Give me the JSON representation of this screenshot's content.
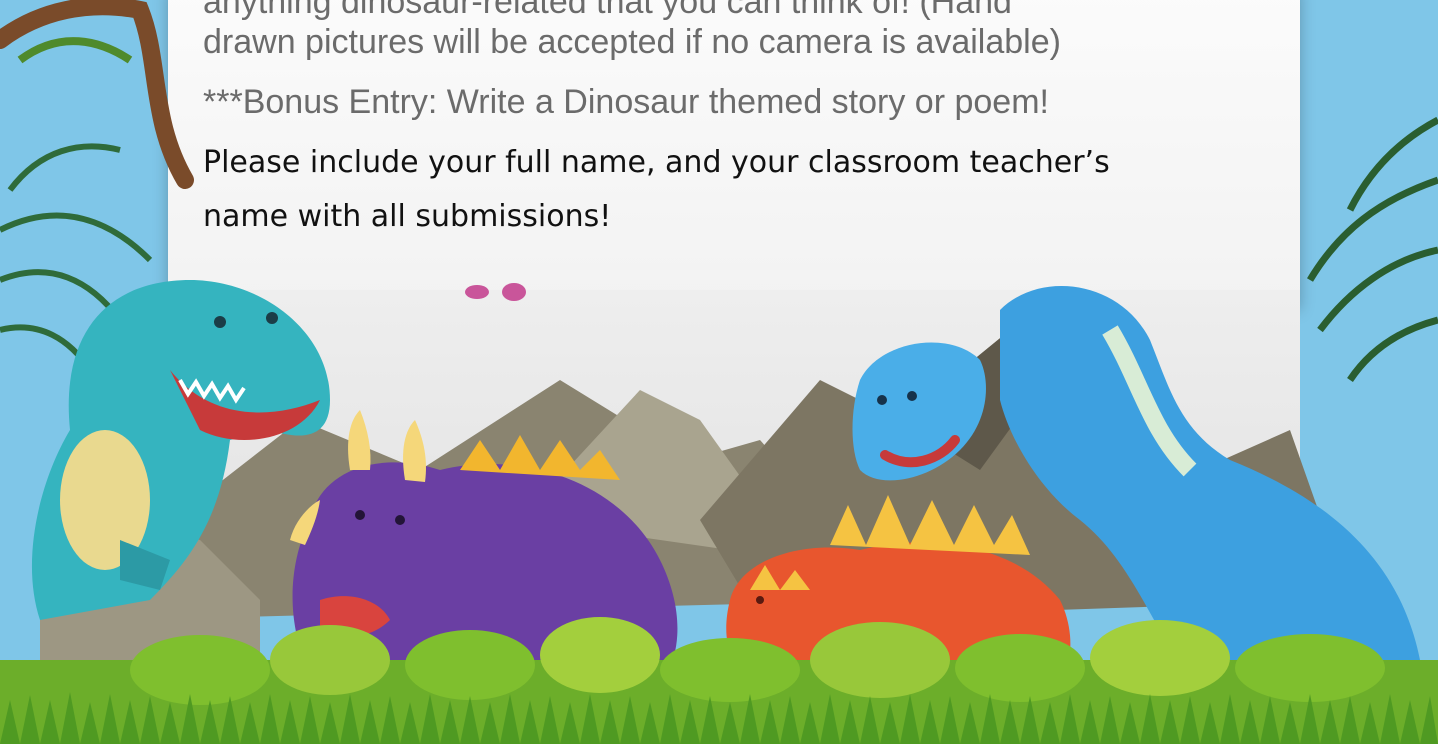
{
  "document": {
    "line1": "anything dinosaur-related that you can think of! (Hand",
    "line2": "drawn pictures will be accepted if no camera is available)",
    "bonus": "***Bonus Entry:  Write a Dinosaur themed story or poem!",
    "note_line1": "Please include your full name, and your classroom teacher’s",
    "note_line2": "name with all submissions!"
  },
  "illustration": {
    "subjects": [
      "t-rex",
      "triceratops",
      "brontosaurus",
      "stegosaurus",
      "mountains",
      "palm-leaves",
      "grass"
    ],
    "colors": {
      "sky": "#7fc6e8",
      "paper": "#f4f4f4",
      "trex": "#35b4bf",
      "triceratops": "#6a3fa3",
      "brontosaurus": "#3da0e0",
      "stegosaurus": "#e8562e",
      "grass": "#6cae2a"
    }
  }
}
